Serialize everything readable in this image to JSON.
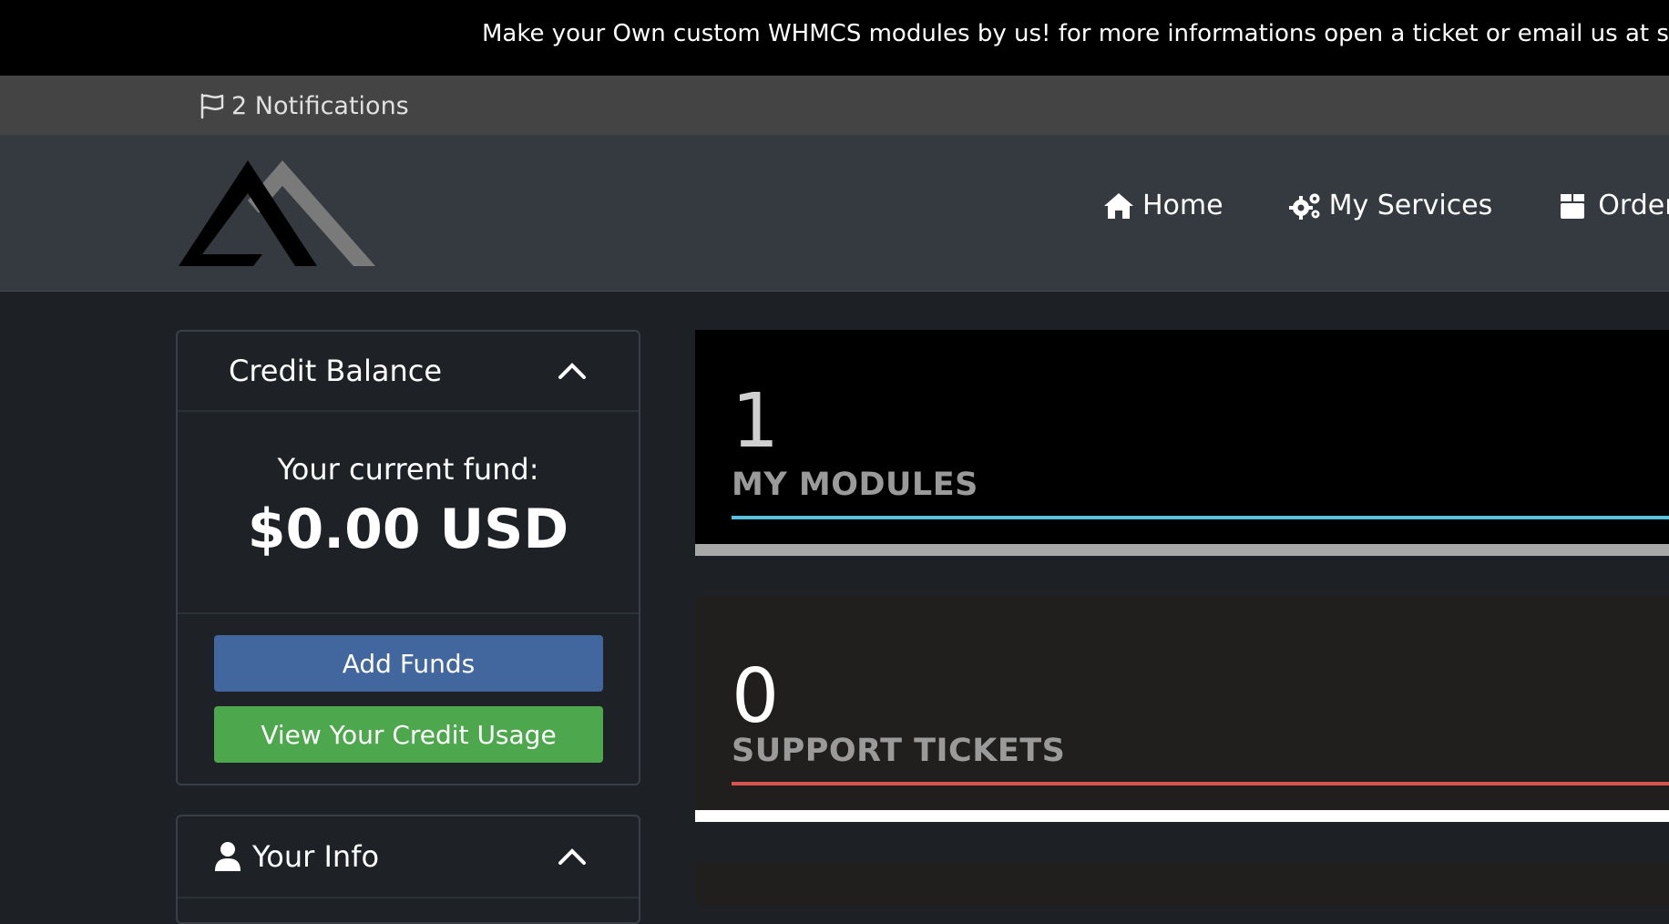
{
  "announcement": {
    "text": "Make your Own custom WHMCS modules by us! for more informations open a ticket or email us at support@"
  },
  "notifications": {
    "icon": "flag-icon",
    "label": "2 Notifications"
  },
  "header": {
    "logo": "brand-logo",
    "nav": [
      {
        "icon": "home-icon",
        "label": "Home"
      },
      {
        "icon": "cogs-icon",
        "label": "My Services"
      },
      {
        "icon": "box-icon",
        "label": "Order M"
      }
    ]
  },
  "credit_balance": {
    "title": "Credit Balance",
    "fund_label": "Your current fund:",
    "amount": "$0.00 USD",
    "add_funds_label": "Add Funds",
    "view_usage_label": "View Your Credit Usage"
  },
  "your_info": {
    "title": "Your Info",
    "icon": "user-icon"
  },
  "stats": [
    {
      "count": "1",
      "label": "MY MODULES",
      "color": "#5bc0de"
    },
    {
      "count": "0",
      "label": "SUPPORT TICKETS",
      "color": "#d9534f"
    }
  ],
  "colors": {
    "announcement_bg": "#000000",
    "notif_bar_bg": "#444444",
    "header_bg": "#343a40",
    "page_bg": "#1d2126",
    "add_funds_btn": "#41679e",
    "credit_usage_btn": "#4da74d"
  }
}
